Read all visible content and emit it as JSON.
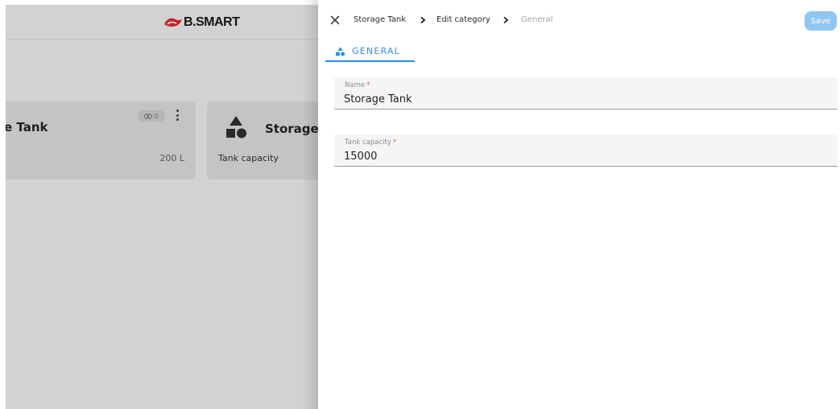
{
  "background": {
    "logo": {
      "text": "B.SMART",
      "brand_color": "#c0262d"
    },
    "cards": [
      {
        "title": "e Tank",
        "value": "200 L",
        "link_count": "0",
        "icons": [
          "link-icon",
          "more-vertical-icon"
        ]
      },
      {
        "title": "Storage",
        "subtitle": "Tank capacity",
        "icon": "shapes-icon"
      }
    ]
  },
  "drawer": {
    "close_icon": "close-icon",
    "breadcrumb": [
      "Storage Tank",
      "Edit category",
      "General"
    ],
    "save_label": "Save",
    "accent_color": "#2f8ee3",
    "tabs": [
      {
        "label": "GENERAL",
        "icon": "shapes-icon",
        "active": true
      }
    ],
    "fields": [
      {
        "label": "Name",
        "required_mark": "*",
        "value": "Storage Tank"
      },
      {
        "label": "Tank capacity",
        "required_mark": "*",
        "value": "15000"
      }
    ]
  }
}
